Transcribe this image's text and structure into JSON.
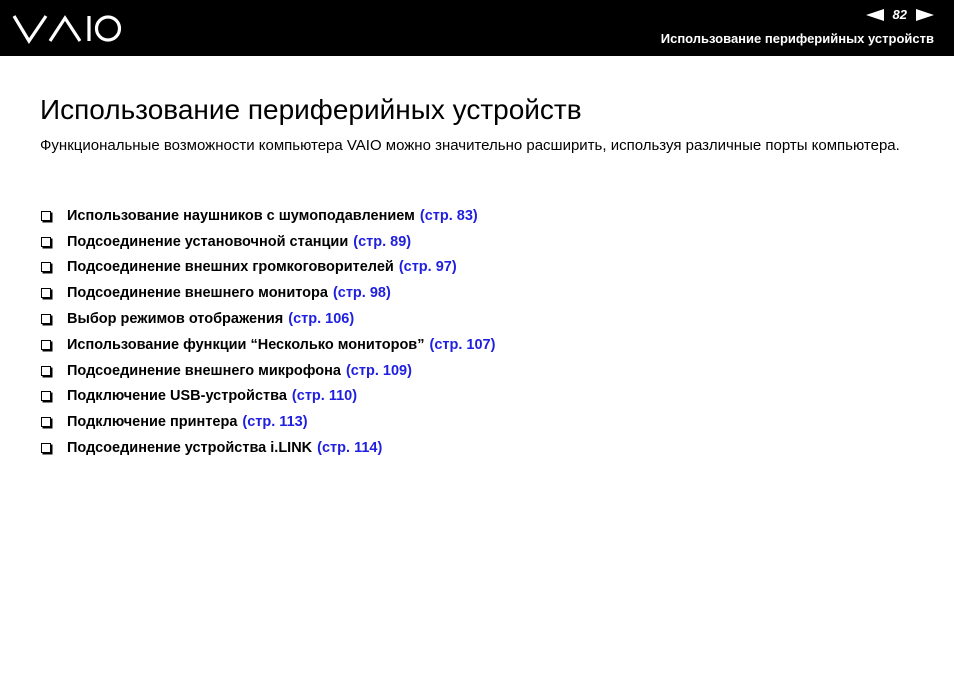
{
  "header": {
    "logo_text": "VAIO",
    "page_number": "82",
    "section_title": "Использование периферийных устройств",
    "prev_icon": "left-triangle-arrow",
    "next_icon": "right-triangle-arrow"
  },
  "main": {
    "title": "Использование периферийных устройств",
    "intro": "Функциональные возможности компьютера VAIO можно значительно расширить, используя различные порты компьютера.",
    "topics": [
      {
        "text": "Использование наушников с шумоподавлением",
        "link": "(стр. 83)"
      },
      {
        "text": "Подсоединение установочной станции",
        "link": "(стр. 89)"
      },
      {
        "text": "Подсоединение внешних громкоговорителей",
        "link": "(стр. 97)"
      },
      {
        "text": "Подсоединение внешнего монитора",
        "link": "(стр. 98)"
      },
      {
        "text": "Выбор режимов отображения",
        "link": "(стр. 106)"
      },
      {
        "text": "Использование функции “Несколько мониторов”",
        "link": "(стр. 107)"
      },
      {
        "text": "Подсоединение внешнего микрофона",
        "link": "(стр. 109)"
      },
      {
        "text": "Подключение USB-устройства",
        "link": "(стр. 110)"
      },
      {
        "text": "Подключение принтера",
        "link": "(стр. 113)"
      },
      {
        "text": "Подсоединение устройства i.LINK",
        "link": "(стр. 114)"
      }
    ]
  },
  "colors": {
    "header_bg": "#000000",
    "link": "#1f1fe0"
  }
}
